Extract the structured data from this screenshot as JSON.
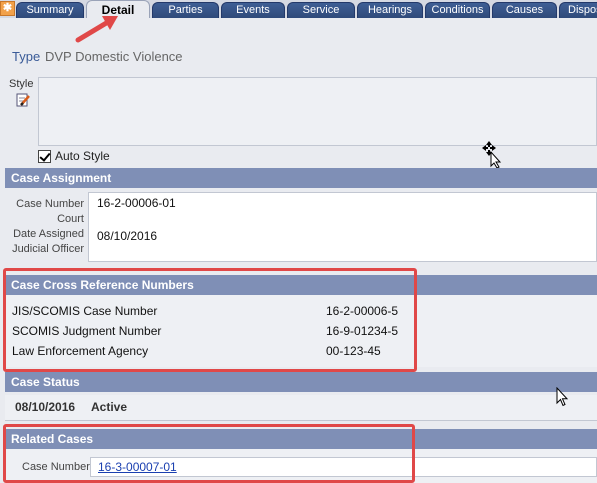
{
  "tabs": [
    {
      "label": "Summary"
    },
    {
      "label": "Detail",
      "active": true
    },
    {
      "label": "Parties"
    },
    {
      "label": "Events"
    },
    {
      "label": "Service"
    },
    {
      "label": "Hearings"
    },
    {
      "label": "Conditions"
    },
    {
      "label": "Causes"
    },
    {
      "label": "Dispos"
    }
  ],
  "type": {
    "label": "Type",
    "value": "DVP Domestic Violence"
  },
  "style": {
    "label": "Style",
    "auto_style_label": "Auto Style",
    "auto_style_checked": true
  },
  "case_assignment": {
    "title": "Case Assignment",
    "labels": [
      "Case Number",
      "Court",
      "Date Assigned",
      "Judicial Officer"
    ],
    "case_number": "16-2-00006-01",
    "court": "",
    "date_assigned": "08/10/2016",
    "judicial_officer": ""
  },
  "cross_reference": {
    "title": "Case Cross Reference Numbers",
    "rows": [
      {
        "label": "JIS/SCOMIS Case Number",
        "value": "16-2-00006-5"
      },
      {
        "label": "SCOMIS Judgment Number",
        "value": "16-9-01234-5"
      },
      {
        "label": "Law Enforcement Agency",
        "value": "00-123-45"
      }
    ]
  },
  "case_status": {
    "title": "Case Status",
    "date": "08/10/2016",
    "status": "Active"
  },
  "related_cases": {
    "title": "Related Cases",
    "label": "Case Number",
    "link": "16-3-00007-01"
  },
  "colors": {
    "tab": "#2f4a7a",
    "header": "#7f8fb6",
    "highlight": "#e04848",
    "link": "#1a3fb0"
  }
}
